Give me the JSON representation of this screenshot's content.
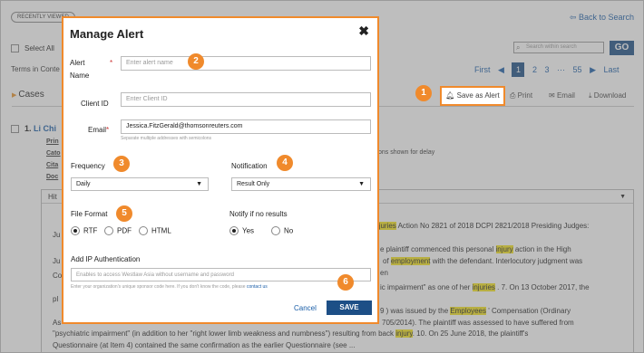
{
  "background": {
    "recently_viewed": "RECENTLY VIEWED",
    "back_to_search": "Back to Search",
    "select_all": "Select All",
    "terms_in_context": "Terms in Conte",
    "search_placeholder": "Search within search",
    "go": "GO",
    "pager": {
      "first": "First",
      "prev": "◀",
      "current": "1",
      "p2": "2",
      "p3": "3",
      "ellipsis": "···",
      "p55": "55",
      "next": "▶",
      "last": "Last"
    },
    "cases": "Cases",
    "toolbar": {
      "save_as_alert": "Save as Alert",
      "print": "Print",
      "email": "Email",
      "download": "Download"
    },
    "result_number": "1.",
    "result_title": "Li Chi",
    "meta_rows": [
      "Prin",
      "Cato",
      "Cita",
      "Doc"
    ],
    "delay_text": "ons shown for delay",
    "hit_label": "Hit",
    "hit_lines": {
      "l1a": "Ju",
      "l1b": "Injuries",
      "l1c": "Action No 2821 of 2018 DCPI 2821/2018 Presiding Judges:",
      "l2": "Ju",
      "l3a": "e plaintiff commenced this personal",
      "l3b": "injury",
      "l3c": "action in the High",
      "l4a": "Co",
      "l4b": "of",
      "l4c": "employment",
      "l4d": "with the defendant. Interlocutory judgment was",
      "l5": "en",
      "l6a": "ic impairment\" as one of her",
      "l6b": "injuries",
      "l6c": ". 7. On 13 October 2017, the",
      "l7": "pl",
      "l8a": "9 ) was issued by the",
      "l8b": "Employees",
      "l8c": "' Compensation (Ordinary",
      "l9a": "As",
      "l9b": "705/2014). The plaintiff was assessed to have suffered from",
      "l10a": "\"psychiatric impairment\" (in addition to her \"right lower limb weakness and numbness\") resulting from back",
      "l10b": "injury",
      "l10c": ". 10. On 25 June 2018, the plaintiff's",
      "l11": "Questionnaire (at Item 4) contained the same confirmation as the earlier Questionnaire (see ..."
    }
  },
  "dialog": {
    "title": "Manage Alert",
    "close": "✖",
    "alert_name_label_1": "Alert",
    "alert_name_label_2": "Name",
    "required_mark": "*",
    "alert_name_placeholder": "Enter alert name",
    "client_id_label": "Client ID",
    "client_id_placeholder": "Enter Client ID",
    "email_label": "Email",
    "email_value": "Jessica.FitzGerald@thomsonreuters.com",
    "email_hint": "Separate multiple addresses with semicolons",
    "frequency_label": "Frequency",
    "frequency_value": "Daily",
    "notification_label": "Notification",
    "notification_value": "Result Only",
    "file_format_label": "File Format",
    "formats": [
      "RTF",
      "PDF",
      "HTML"
    ],
    "selected_format": "RTF",
    "notify_label": "Notify if no results",
    "notify_options": [
      "Yes",
      "No"
    ],
    "notify_selected": "Yes",
    "ip_auth_label": "Add IP Authentication",
    "ip_auth_placeholder": "Enables to access Westlaw Asia without username and password",
    "ip_hint": "Enter your organization's unique sponsor code here. If you don't know the code, please",
    "ip_hint_link": "contact us",
    "cancel": "Cancel",
    "save": "SAVE"
  },
  "badges": [
    "1",
    "2",
    "3",
    "4",
    "5",
    "6"
  ],
  "colors": {
    "accent": "#f08a2c",
    "primary": "#1d4f86",
    "highlight": "#f5e31e",
    "link": "#1a5ea8"
  }
}
